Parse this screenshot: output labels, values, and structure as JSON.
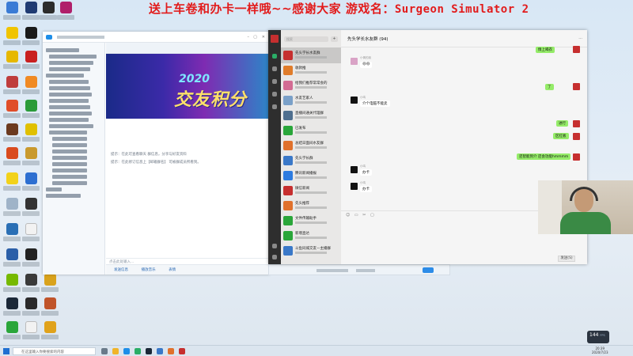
{
  "banner": {
    "text": "送上车卷和办卡一样哦~~感谢大家 游戏名：",
    "game_name": "Surgeon Simulator 2"
  },
  "colors": {
    "banner_red": "#e21b1b",
    "wechat_green": "#95ec69",
    "qq_accent": "#2d6bb5"
  },
  "qq": {
    "promo_year": "2020",
    "promo_title": "交友积分",
    "system_messages": [
      "提示：在此可查看聊天 群信息，分享与好友资料",
      "提示：在此修订信息上【邮箱群名】 可被群成员所看到。"
    ],
    "input_placeholder": "点击此处输入...",
    "bottom_buttons": [
      "发送信息",
      "播放音乐",
      "表情"
    ]
  },
  "wechat": {
    "search_placeholder": "搜索",
    "chat_title": "先头学长水友群 (94)",
    "list": [
      {
        "name": "先头学长水友群",
        "color": "#c62f2f"
      },
      {
        "name": "收款推",
        "color": "#e07c2a"
      },
      {
        "name": "给我们推荐常常会的",
        "color": "#d36b93"
      },
      {
        "name": "水友艺家人",
        "color": "#7aa0c8"
      },
      {
        "name": "直播间通关代理群",
        "color": "#4f6f8f"
      },
      {
        "name": "已发布",
        "color": "#2aa63a"
      },
      {
        "name": "总结日面间水友群",
        "color": "#e0712c"
      },
      {
        "name": "先头学长群",
        "color": "#3a78c8"
      },
      {
        "name": "腾讯新闻播报",
        "color": "#2d7be0"
      },
      {
        "name": "微信新闻",
        "color": "#c62f2f"
      },
      {
        "name": "先头推荐",
        "color": "#e0712c"
      },
      {
        "name": "文件传输助手",
        "color": "#2aa63a"
      },
      {
        "name": "新增直达",
        "color": "#2aa63a"
      },
      {
        "name": "斗鱼同城交友—主播群",
        "color": "#3a78c8"
      }
    ],
    "messages": [
      {
        "side": "right",
        "text": "情上喝衣"
      },
      {
        "side": "left",
        "nick": "小情的朋",
        "text": "😄😄"
      },
      {
        "side": "right",
        "text": "了"
      },
      {
        "side": "left",
        "nick": "小鸣",
        "text": "介个电脑不能卖"
      },
      {
        "side": "right",
        "text": "进行"
      },
      {
        "side": "right",
        "text": "区红板"
      },
      {
        "side": "right",
        "text": "还智能到介 还会功能hmmmm"
      },
      {
        "side": "left",
        "nick": "小鸣",
        "text": "办卡"
      },
      {
        "side": "left",
        "nick": "小鸣",
        "text": "办卡"
      }
    ],
    "send_label": "发送(S)"
  },
  "taskbar": {
    "search_placeholder": "在这里输入你要搜索的内容",
    "time": "20:39",
    "date": "2020/7/23",
    "fps_value": "144",
    "fps_label": "FPS"
  }
}
